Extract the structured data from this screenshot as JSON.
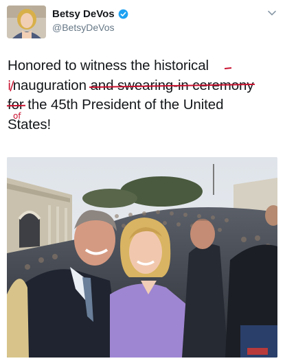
{
  "user": {
    "display_name": "Betsy DeVos",
    "handle": "@BetsyDeVos",
    "verified": true,
    "avatar_icon": "profile-photo"
  },
  "tweet": {
    "line1": "Honored to witness the historical",
    "line2_pre": "",
    "line2_word": "nauguration",
    "line2_strike": "and swearing-in ceremony",
    "line3_strike": "for",
    "line3_rest": "the 45th President of the United",
    "line4": "States!"
  },
  "edits": {
    "insert_i": "i/",
    "insert_of": "of"
  },
  "colors": {
    "accent": "#1da1f2",
    "edit_red": "#c8102e",
    "text": "#14171a",
    "secondary": "#657786"
  },
  "media": {
    "type": "photo",
    "icon": "inauguration-photo"
  }
}
